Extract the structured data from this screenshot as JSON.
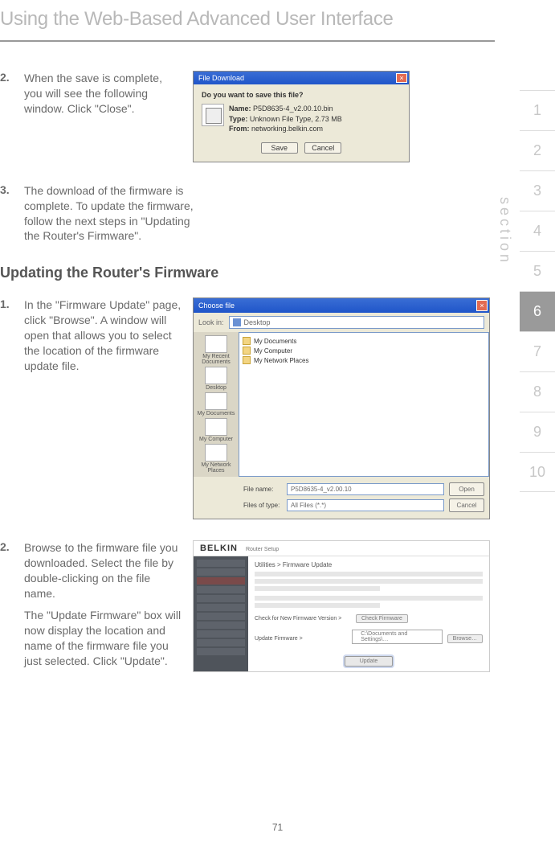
{
  "page_title": "Using the Web-Based Advanced User Interface",
  "steps_a": [
    {
      "num": "2.",
      "text": "When the save is complete, you will see the following window. Click \"Close\"."
    },
    {
      "num": "3.",
      "text": "The download of the firmware is complete. To update the firmware, follow the next steps in \"Updating the Router's Firmware\"."
    }
  ],
  "subheading": "Updating the Router's Firmware",
  "steps_b": [
    {
      "num": "1.",
      "text": "In the \"Firmware Update\" page, click \"Browse\". A window will open that allows you to select the location of the firmware update file."
    },
    {
      "num": "2.",
      "text": "Browse to the firmware file you downloaded. Select the file by double-clicking on the file name.",
      "text2": "The \"Update Firmware\" box will now display the location and name of the firmware file you just selected. Click \"Update\"."
    }
  ],
  "dlg1": {
    "title": "File Download",
    "question": "Do you want to save this file?",
    "name_lbl": "Name:",
    "name_val": "P5D8635-4_v2.00.10.bin",
    "type_lbl": "Type:",
    "type_val": "Unknown File Type, 2.73 MB",
    "from_lbl": "From:",
    "from_val": "networking.belkin.com",
    "save": "Save",
    "cancel": "Cancel"
  },
  "dlg2": {
    "title": "Choose file",
    "lookin_lbl": "Look in:",
    "lookin_val": "Desktop",
    "places": [
      "My Recent Documents",
      "Desktop",
      "My Documents",
      "My Computer",
      "My Network Places"
    ],
    "files": [
      "My Documents",
      "My Computer",
      "My Network Places"
    ],
    "filename_lbl": "File name:",
    "filename_val": "P5D8635-4_v2.00.10",
    "filetype_lbl": "Files of type:",
    "filetype_val": "All Files (*.*)",
    "open": "Open",
    "cancel": "Cancel"
  },
  "router": {
    "brand": "BELKIN",
    "sub": "Router Setup",
    "crumb": "Utilities > Firmware Update",
    "check_lbl": "Check for New Firmware Version >",
    "check_btn": "Check Firmware",
    "update_lbl": "Update Firmware >",
    "update_val": "C:\\Documents and Settings\\…",
    "browse_btn": "Browse…",
    "update_btn": "Update"
  },
  "section_nav": [
    "1",
    "2",
    "3",
    "4",
    "5",
    "6",
    "7",
    "8",
    "9",
    "10"
  ],
  "section_active_index": 5,
  "section_label": "section",
  "page_number": "71"
}
